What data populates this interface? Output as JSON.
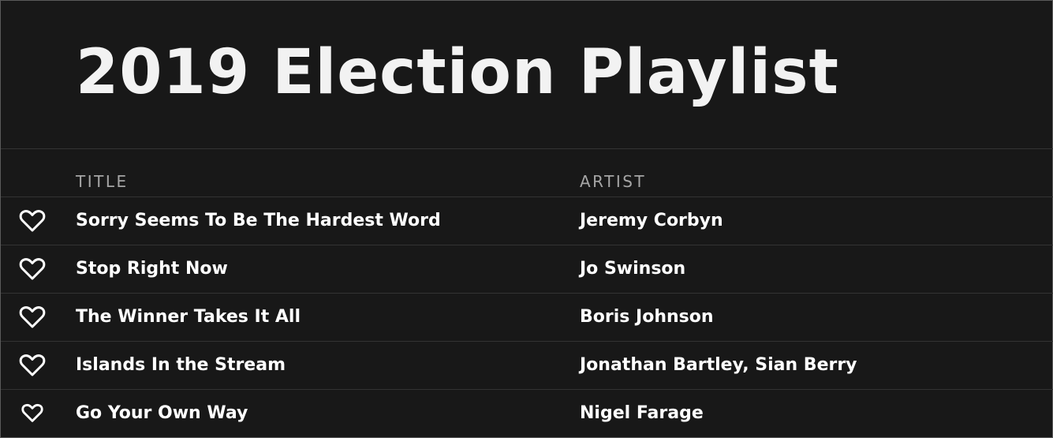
{
  "playlist": {
    "title": "2019 Election Playlist"
  },
  "columns": {
    "title": "TITLE",
    "artist": "ARTIST"
  },
  "tracks": [
    {
      "title": "Sorry Seems To Be The Hardest Word",
      "artist": "Jeremy Corbyn",
      "icon": "heart-outline-icon"
    },
    {
      "title": "Stop Right Now",
      "artist": "Jo Swinson",
      "icon": "heart-outline-icon"
    },
    {
      "title": "The Winner Takes It All",
      "artist": "Boris Johnson",
      "icon": "heart-outline-icon"
    },
    {
      "title": "Islands In the Stream",
      "artist": "Jonathan Bartley, Sian Berry",
      "icon": "heart-outline-icon"
    },
    {
      "title": "Go Your Own Way",
      "artist": "Nigel Farage",
      "icon": "heart-outline-icon"
    }
  ],
  "colors": {
    "background": "#181818",
    "divider": "#333333",
    "text": "#ffffff",
    "header_text": "#a6a6a6"
  }
}
